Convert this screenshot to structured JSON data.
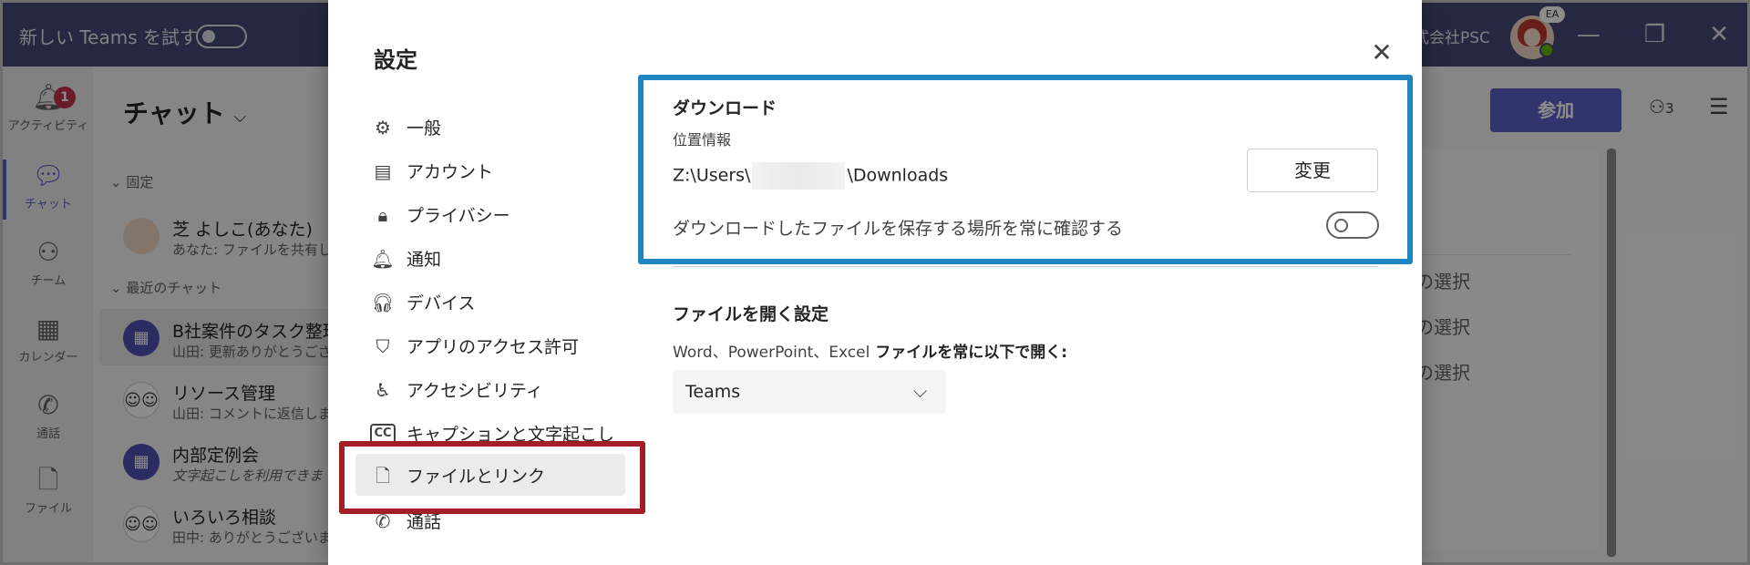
{
  "titlebar": {
    "try_new_teams": "新しい Teams を試す",
    "org_name": "式会社PSC",
    "avatar_initials": "EA",
    "win_min": "—",
    "win_max": "❐",
    "win_close": "✕"
  },
  "rail": {
    "items": [
      {
        "label": "アクティビティ",
        "icon": "bell-icon",
        "badge": "1"
      },
      {
        "label": "チャット",
        "icon": "chat-icon"
      },
      {
        "label": "チーム",
        "icon": "teams-icon"
      },
      {
        "label": "カレンダー",
        "icon": "calendar-icon"
      },
      {
        "label": "通話",
        "icon": "phone-icon"
      },
      {
        "label": "ファイル",
        "icon": "file-icon"
      }
    ]
  },
  "chatlist": {
    "header": "チャット",
    "pinned": "固定",
    "recent": "最近のチャット",
    "items": [
      {
        "name": "芝 よしこ(あなた)",
        "preview": "あなた: ファイルを共有しま"
      },
      {
        "name": "B社案件のタスク整理",
        "preview": "山田: 更新ありがとうござい"
      },
      {
        "name": "リソース管理",
        "preview": "山田: コメントに返信しま"
      },
      {
        "name": "内部定例会",
        "preview": "文字起こしを利用できま"
      },
      {
        "name": "いろいろ相談",
        "preview": "田中: ありがとうございます"
      }
    ]
  },
  "rightpane": {
    "join_label": "参加",
    "people_count": "3",
    "fragments": [
      "の選択",
      "の選択",
      "の選択"
    ]
  },
  "dialog": {
    "title": "設定",
    "nav": [
      {
        "label": "一般",
        "icon": "gear-icon"
      },
      {
        "label": "アカウント",
        "icon": "id-card-icon"
      },
      {
        "label": "プライバシー",
        "icon": "lock-icon"
      },
      {
        "label": "通知",
        "icon": "bell-icon"
      },
      {
        "label": "デバイス",
        "icon": "headset-icon"
      },
      {
        "label": "アプリのアクセス許可",
        "icon": "shield-icon"
      },
      {
        "label": "アクセシビリティ",
        "icon": "accessibility-icon"
      },
      {
        "label": "キャプションと文字起こし",
        "icon": "cc-icon"
      },
      {
        "label": "ファイルとリンク",
        "icon": "file-icon"
      },
      {
        "label": "通話",
        "icon": "phone-icon"
      }
    ],
    "download": {
      "title": "ダウンロード",
      "location_label": "位置情報",
      "path_prefix": "Z:\\Users\\",
      "path_suffix": "\\Downloads",
      "change_label": "変更",
      "ask_label": "ダウンロードしたファイルを保存する場所を常に確認する"
    },
    "open_files": {
      "title": "ファイルを開く設定",
      "apps": "Word、PowerPoint、Excel",
      "rest": " ファイルを常に以下で開く:",
      "selected": "Teams"
    }
  },
  "colors": {
    "brand": "#464775",
    "accent": "#5b5fc7",
    "highlight_blue": "#1f86c3",
    "highlight_red": "#a31d25"
  }
}
